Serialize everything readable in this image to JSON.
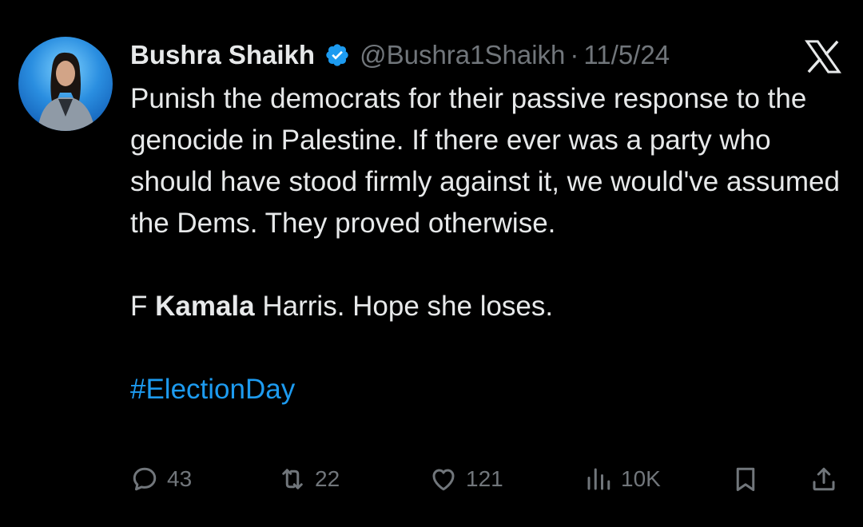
{
  "author": {
    "name": "Bushra Shaikh",
    "handle": "@Bushra1Shaikh",
    "separator": "·",
    "date": "11/5/24",
    "verified_color": "#1d9bf0"
  },
  "post": {
    "paragraph1": "Punish the democrats for their passive  response to the genocide in Palestine. If there ever was a party who should have stood firmly against it, we would've assumed the Dems. They proved otherwise.",
    "paragraph2": {
      "prefix": "F ",
      "bold": "Kamala",
      "suffix": " Harris. Hope she loses."
    },
    "hashtag": "#ElectionDay"
  },
  "actions": {
    "replies": "43",
    "reposts": "22",
    "likes": "121",
    "views": "10K"
  },
  "icons": {
    "reply": "reply-icon",
    "repost": "repost-icon",
    "like": "heart-icon",
    "views": "views-icon",
    "bookmark": "bookmark-icon",
    "share": "share-icon",
    "brand": "x-logo-icon"
  },
  "colors": {
    "background": "#000000",
    "text": "#e7e9ea",
    "muted": "#71767b",
    "accent": "#1d9bf0"
  }
}
